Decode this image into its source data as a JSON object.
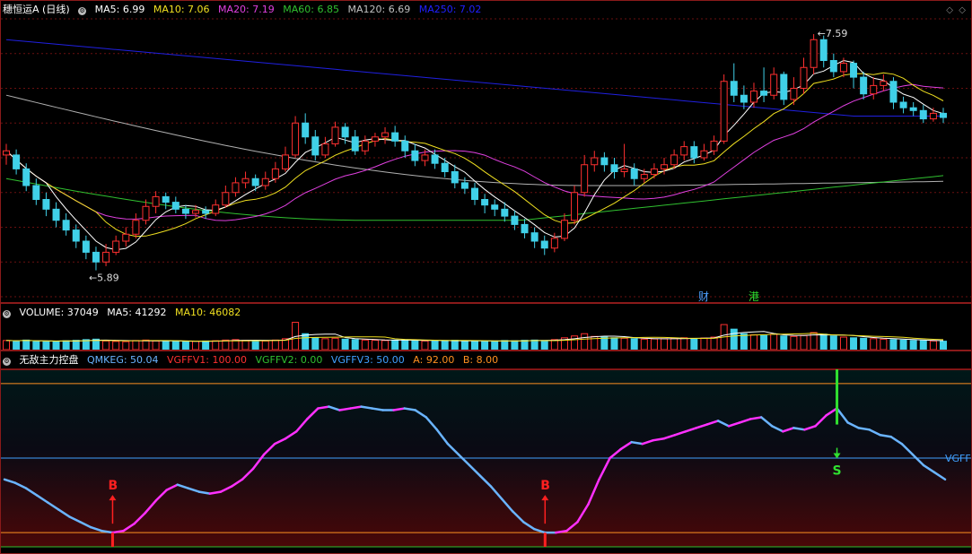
{
  "colors": {
    "ma5": "#ffffff",
    "ma10": "#f0e020",
    "ma20": "#e040e0",
    "ma60": "#30c030",
    "ma120": "#b0b0b0",
    "ma250": "#2020e0",
    "up": "#ff3030",
    "down": "#40d0e8",
    "vgffv1": "#ff2a2a",
    "vgffv2": "#30c030",
    "vgffv3": "#40a0ff",
    "a": "#ff9020",
    "b": "#ff9020"
  },
  "main_header": {
    "title": "穗恒运A (日线)",
    "ma5": "MA5: 6.99",
    "ma10": "MA10: 7.06",
    "ma20": "MA20: 7.19",
    "ma60": "MA60: 6.85",
    "ma120": "MA120: 6.69",
    "ma250": "MA250: 7.02"
  },
  "vol_header": {
    "volume": "VOLUME: 37049",
    "ma5": "MA5: 41292",
    "ma10": "MA10: 46082"
  },
  "ind_header": {
    "title": "无敌主力控盘",
    "qmkeg": "QMKEG: 50.04",
    "vgffv1": "VGFFV1: 100.00",
    "vgffv2": "VGFFV2: 0.00",
    "vgffv3": "VGFFV3: 50.00",
    "a": "A: 92.00",
    "b": "B: 8.00"
  },
  "chart_data": [
    {
      "type": "candlestick",
      "high_label": "7.59",
      "low_label": "5.89",
      "markers": [
        "财",
        "港"
      ],
      "candles": [
        [
          6.72,
          6.75,
          6.65,
          6.8
        ],
        [
          6.72,
          6.62,
          6.58,
          6.76
        ],
        [
          6.62,
          6.5,
          6.46,
          6.66
        ],
        [
          6.5,
          6.4,
          6.36,
          6.55
        ],
        [
          6.4,
          6.33,
          6.28,
          6.45
        ],
        [
          6.33,
          6.25,
          6.2,
          6.38
        ],
        [
          6.25,
          6.18,
          6.14,
          6.3
        ],
        [
          6.18,
          6.1,
          6.05,
          6.22
        ],
        [
          6.1,
          6.02,
          5.97,
          6.14
        ],
        [
          6.02,
          5.95,
          5.89,
          6.06
        ],
        [
          5.95,
          6.02,
          5.92,
          6.08
        ],
        [
          6.02,
          6.1,
          6.0,
          6.14
        ],
        [
          6.1,
          6.15,
          6.06,
          6.2
        ],
        [
          6.15,
          6.25,
          6.12,
          6.3
        ],
        [
          6.25,
          6.35,
          6.22,
          6.4
        ],
        [
          6.35,
          6.42,
          6.3,
          6.46
        ],
        [
          6.42,
          6.38,
          6.33,
          6.45
        ],
        [
          6.38,
          6.33,
          6.3,
          6.42
        ],
        [
          6.33,
          6.3,
          6.26,
          6.36
        ],
        [
          6.3,
          6.32,
          6.27,
          6.36
        ],
        [
          6.32,
          6.3,
          6.26,
          6.35
        ],
        [
          6.3,
          6.36,
          6.28,
          6.4
        ],
        [
          6.36,
          6.45,
          6.34,
          6.5
        ],
        [
          6.45,
          6.52,
          6.42,
          6.56
        ],
        [
          6.52,
          6.55,
          6.48,
          6.6
        ],
        [
          6.55,
          6.5,
          6.46,
          6.58
        ],
        [
          6.5,
          6.55,
          6.47,
          6.6
        ],
        [
          6.55,
          6.62,
          6.52,
          6.67
        ],
        [
          6.62,
          6.72,
          6.6,
          6.78
        ],
        [
          6.72,
          6.95,
          6.7,
          7.0
        ],
        [
          6.95,
          6.85,
          6.8,
          7.02
        ],
        [
          6.85,
          6.72,
          6.68,
          6.9
        ],
        [
          6.72,
          6.8,
          6.7,
          6.85
        ],
        [
          6.8,
          6.92,
          6.78,
          6.96
        ],
        [
          6.92,
          6.85,
          6.8,
          6.95
        ],
        [
          6.85,
          6.75,
          6.72,
          6.9
        ],
        [
          6.75,
          6.82,
          6.72,
          6.86
        ],
        [
          6.82,
          6.85,
          6.78,
          6.88
        ],
        [
          6.85,
          6.88,
          6.8,
          6.92
        ],
        [
          6.88,
          6.82,
          6.78,
          6.93
        ],
        [
          6.82,
          6.75,
          6.7,
          6.86
        ],
        [
          6.75,
          6.68,
          6.64,
          6.8
        ],
        [
          6.68,
          6.72,
          6.64,
          6.76
        ],
        [
          6.72,
          6.66,
          6.62,
          6.76
        ],
        [
          6.66,
          6.6,
          6.56,
          6.7
        ],
        [
          6.6,
          6.52,
          6.48,
          6.65
        ],
        [
          6.52,
          6.48,
          6.44,
          6.56
        ],
        [
          6.48,
          6.4,
          6.36,
          6.52
        ],
        [
          6.4,
          6.36,
          6.3,
          6.44
        ],
        [
          6.36,
          6.33,
          6.28,
          6.4
        ],
        [
          6.33,
          6.28,
          6.24,
          6.38
        ],
        [
          6.28,
          6.22,
          6.18,
          6.32
        ],
        [
          6.22,
          6.16,
          6.12,
          6.26
        ],
        [
          6.16,
          6.1,
          6.05,
          6.2
        ],
        [
          6.1,
          6.05,
          6.0,
          6.14
        ],
        [
          6.05,
          6.12,
          6.02,
          6.16
        ],
        [
          6.12,
          6.25,
          6.1,
          6.3
        ],
        [
          6.25,
          6.45,
          6.22,
          6.5
        ],
        [
          6.45,
          6.65,
          6.42,
          6.72
        ],
        [
          6.65,
          6.7,
          6.6,
          6.75
        ],
        [
          6.7,
          6.65,
          6.6,
          6.74
        ],
        [
          6.65,
          6.6,
          6.55,
          6.7
        ],
        [
          6.6,
          6.62,
          6.56,
          6.8
        ],
        [
          6.62,
          6.55,
          6.5,
          6.66
        ],
        [
          6.55,
          6.58,
          6.52,
          6.62
        ],
        [
          6.58,
          6.62,
          6.55,
          6.66
        ],
        [
          6.62,
          6.65,
          6.58,
          6.7
        ],
        [
          6.65,
          6.72,
          6.62,
          6.76
        ],
        [
          6.72,
          6.78,
          6.68,
          6.82
        ],
        [
          6.78,
          6.7,
          6.66,
          6.82
        ],
        [
          6.7,
          6.75,
          6.68,
          6.8
        ],
        [
          6.75,
          6.82,
          6.72,
          6.86
        ],
        [
          6.82,
          7.25,
          6.8,
          7.3
        ],
        [
          7.25,
          7.15,
          7.1,
          7.38
        ],
        [
          7.15,
          7.1,
          7.05,
          7.22
        ],
        [
          7.1,
          7.18,
          7.06,
          7.24
        ],
        [
          7.18,
          7.15,
          7.1,
          7.35
        ],
        [
          7.15,
          7.3,
          7.12,
          7.35
        ],
        [
          7.3,
          7.12,
          7.08,
          7.32
        ],
        [
          7.12,
          7.2,
          7.08,
          7.28
        ],
        [
          7.2,
          7.35,
          7.16,
          7.42
        ],
        [
          7.35,
          7.55,
          7.3,
          7.59
        ],
        [
          7.55,
          7.4,
          7.35,
          7.58
        ],
        [
          7.4,
          7.32,
          7.28,
          7.45
        ],
        [
          7.32,
          7.38,
          7.28,
          7.42
        ],
        [
          7.38,
          7.28,
          7.2,
          7.4
        ],
        [
          7.28,
          7.16,
          7.12,
          7.32
        ],
        [
          7.16,
          7.22,
          7.12,
          7.28
        ],
        [
          7.22,
          7.25,
          7.18,
          7.3
        ],
        [
          7.25,
          7.1,
          7.05,
          7.28
        ],
        [
          7.1,
          7.06,
          7.02,
          7.14
        ],
        [
          7.06,
          7.04,
          7.0,
          7.1
        ],
        [
          7.04,
          6.98,
          6.95,
          7.08
        ],
        [
          6.98,
          7.02,
          6.96,
          7.06
        ],
        [
          7.02,
          6.99,
          6.95,
          7.06
        ]
      ]
    },
    {
      "type": "bar",
      "series_name": "VOLUME",
      "values": [
        40000,
        38000,
        42000,
        36000,
        35000,
        37000,
        39000,
        41000,
        44000,
        46000,
        38000,
        36000,
        35000,
        40000,
        42000,
        38000,
        37000,
        36000,
        35000,
        37000,
        38000,
        39000,
        42000,
        44000,
        41000,
        40000,
        38000,
        42000,
        48000,
        120000,
        70000,
        52000,
        48000,
        50000,
        46000,
        44000,
        42000,
        41000,
        40000,
        42000,
        44000,
        39000,
        38000,
        37000,
        40000,
        41000,
        38000,
        37000,
        36000,
        38000,
        40000,
        39000,
        41000,
        42000,
        40000,
        44000,
        52000,
        60000,
        70000,
        58000,
        55000,
        52000,
        50000,
        48000,
        46000,
        47000,
        48000,
        50000,
        52000,
        49000,
        51000,
        55000,
        110000,
        90000,
        70000,
        65000,
        62000,
        68000,
        60000,
        58000,
        62000,
        75000,
        68000,
        60000,
        55000,
        52000,
        50000,
        48000,
        46000,
        44000,
        42000,
        40000,
        39000,
        38000,
        37049
      ]
    },
    {
      "type": "line",
      "series": [
        {
          "name": "QMKEG",
          "values": [
            38,
            36,
            33,
            29,
            25,
            21,
            17,
            14,
            11,
            9,
            8,
            9,
            13,
            19,
            26,
            32,
            35,
            33,
            31,
            30,
            31,
            34,
            38,
            44,
            52,
            58,
            61,
            65,
            72,
            78,
            79,
            77,
            78,
            79,
            78,
            77,
            77,
            78,
            77,
            73,
            66,
            58,
            52,
            46,
            40,
            34,
            27,
            20,
            14,
            10,
            8,
            8,
            9,
            14,
            24,
            38,
            50,
            55,
            59,
            58,
            60,
            61,
            63,
            65,
            67,
            69,
            71,
            68,
            70,
            72,
            73,
            68,
            65,
            67,
            66,
            68,
            74,
            78,
            70,
            67,
            66,
            63,
            62,
            58,
            52,
            46,
            42,
            38
          ]
        }
      ],
      "ylim": [
        0,
        100
      ],
      "levels": {
        "A": 92,
        "B": 8,
        "VGFFV3": 50
      }
    }
  ],
  "signals": {
    "buy_label": "B",
    "sell_label": "S",
    "right_label": "VGFF"
  }
}
